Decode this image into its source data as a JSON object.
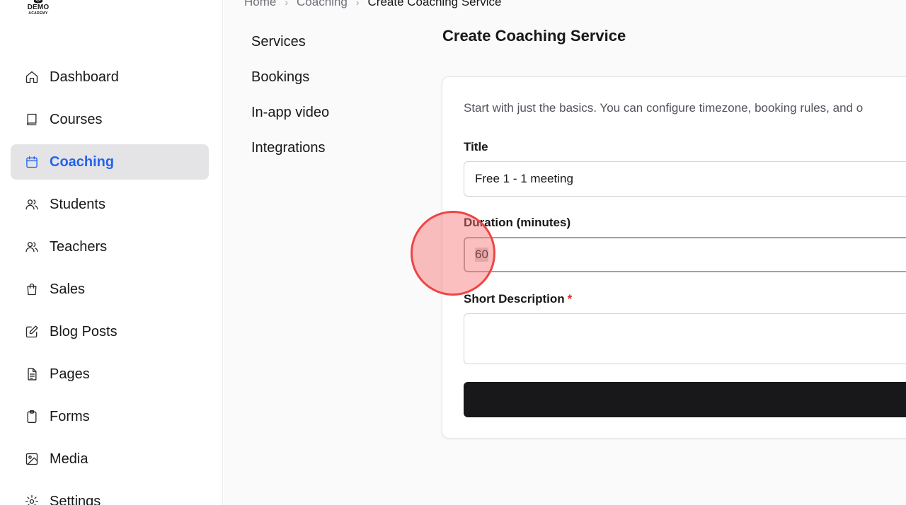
{
  "logo": {
    "line1": "DEMO",
    "line2": "ACADEMY"
  },
  "sidebar": {
    "items": [
      {
        "label": "Dashboard",
        "icon": "home-icon"
      },
      {
        "label": "Courses",
        "icon": "book-icon"
      },
      {
        "label": "Coaching",
        "icon": "calendar-icon",
        "active": true
      },
      {
        "label": "Students",
        "icon": "users-icon"
      },
      {
        "label": "Teachers",
        "icon": "users-icon"
      },
      {
        "label": "Sales",
        "icon": "shopping-bag-icon"
      },
      {
        "label": "Blog Posts",
        "icon": "edit-icon"
      },
      {
        "label": "Pages",
        "icon": "file-text-icon"
      },
      {
        "label": "Forms",
        "icon": "clipboard-icon"
      },
      {
        "label": "Media",
        "icon": "image-icon"
      },
      {
        "label": "Settings",
        "icon": "gear-icon"
      }
    ]
  },
  "breadcrumb": {
    "items": [
      "Home",
      "Coaching",
      "Create Coaching Service"
    ]
  },
  "subnav": {
    "items": [
      "Services",
      "Bookings",
      "In-app video",
      "Integrations"
    ]
  },
  "page": {
    "title": "Create Coaching Service",
    "intro": "Start with just the basics. You can configure timezone, booking rules, and o",
    "title_label": "Title",
    "title_value": "Free 1 - 1 meeting",
    "duration_label": "Duration (minutes)",
    "duration_value": "60",
    "short_desc_label": "Short Description",
    "required_mark": "*",
    "short_desc_value": ""
  },
  "colors": {
    "accent": "#2563eb",
    "active_bg": "#e4e4e7",
    "submit_bg": "#18181b",
    "required": "#dc2626",
    "click_marker": "#ef4444"
  }
}
